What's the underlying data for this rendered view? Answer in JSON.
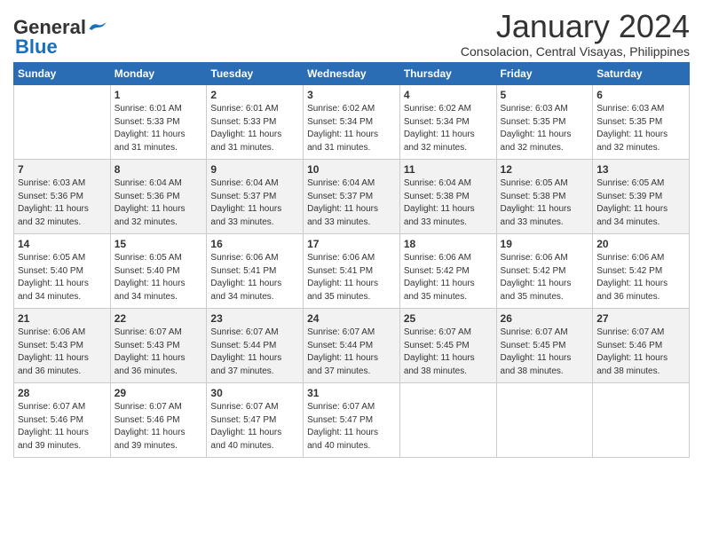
{
  "header": {
    "logo_general": "General",
    "logo_blue": "Blue",
    "month_title": "January 2024",
    "location": "Consolacion, Central Visayas, Philippines"
  },
  "days_of_week": [
    "Sunday",
    "Monday",
    "Tuesday",
    "Wednesday",
    "Thursday",
    "Friday",
    "Saturday"
  ],
  "weeks": [
    [
      {
        "day": "",
        "info": ""
      },
      {
        "day": "1",
        "info": "Sunrise: 6:01 AM\nSunset: 5:33 PM\nDaylight: 11 hours\nand 31 minutes."
      },
      {
        "day": "2",
        "info": "Sunrise: 6:01 AM\nSunset: 5:33 PM\nDaylight: 11 hours\nand 31 minutes."
      },
      {
        "day": "3",
        "info": "Sunrise: 6:02 AM\nSunset: 5:34 PM\nDaylight: 11 hours\nand 31 minutes."
      },
      {
        "day": "4",
        "info": "Sunrise: 6:02 AM\nSunset: 5:34 PM\nDaylight: 11 hours\nand 32 minutes."
      },
      {
        "day": "5",
        "info": "Sunrise: 6:03 AM\nSunset: 5:35 PM\nDaylight: 11 hours\nand 32 minutes."
      },
      {
        "day": "6",
        "info": "Sunrise: 6:03 AM\nSunset: 5:35 PM\nDaylight: 11 hours\nand 32 minutes."
      }
    ],
    [
      {
        "day": "7",
        "info": "Sunrise: 6:03 AM\nSunset: 5:36 PM\nDaylight: 11 hours\nand 32 minutes."
      },
      {
        "day": "8",
        "info": "Sunrise: 6:04 AM\nSunset: 5:36 PM\nDaylight: 11 hours\nand 32 minutes."
      },
      {
        "day": "9",
        "info": "Sunrise: 6:04 AM\nSunset: 5:37 PM\nDaylight: 11 hours\nand 33 minutes."
      },
      {
        "day": "10",
        "info": "Sunrise: 6:04 AM\nSunset: 5:37 PM\nDaylight: 11 hours\nand 33 minutes."
      },
      {
        "day": "11",
        "info": "Sunrise: 6:04 AM\nSunset: 5:38 PM\nDaylight: 11 hours\nand 33 minutes."
      },
      {
        "day": "12",
        "info": "Sunrise: 6:05 AM\nSunset: 5:38 PM\nDaylight: 11 hours\nand 33 minutes."
      },
      {
        "day": "13",
        "info": "Sunrise: 6:05 AM\nSunset: 5:39 PM\nDaylight: 11 hours\nand 34 minutes."
      }
    ],
    [
      {
        "day": "14",
        "info": "Sunrise: 6:05 AM\nSunset: 5:40 PM\nDaylight: 11 hours\nand 34 minutes."
      },
      {
        "day": "15",
        "info": "Sunrise: 6:05 AM\nSunset: 5:40 PM\nDaylight: 11 hours\nand 34 minutes."
      },
      {
        "day": "16",
        "info": "Sunrise: 6:06 AM\nSunset: 5:41 PM\nDaylight: 11 hours\nand 34 minutes."
      },
      {
        "day": "17",
        "info": "Sunrise: 6:06 AM\nSunset: 5:41 PM\nDaylight: 11 hours\nand 35 minutes."
      },
      {
        "day": "18",
        "info": "Sunrise: 6:06 AM\nSunset: 5:42 PM\nDaylight: 11 hours\nand 35 minutes."
      },
      {
        "day": "19",
        "info": "Sunrise: 6:06 AM\nSunset: 5:42 PM\nDaylight: 11 hours\nand 35 minutes."
      },
      {
        "day": "20",
        "info": "Sunrise: 6:06 AM\nSunset: 5:42 PM\nDaylight: 11 hours\nand 36 minutes."
      }
    ],
    [
      {
        "day": "21",
        "info": "Sunrise: 6:06 AM\nSunset: 5:43 PM\nDaylight: 11 hours\nand 36 minutes."
      },
      {
        "day": "22",
        "info": "Sunrise: 6:07 AM\nSunset: 5:43 PM\nDaylight: 11 hours\nand 36 minutes."
      },
      {
        "day": "23",
        "info": "Sunrise: 6:07 AM\nSunset: 5:44 PM\nDaylight: 11 hours\nand 37 minutes."
      },
      {
        "day": "24",
        "info": "Sunrise: 6:07 AM\nSunset: 5:44 PM\nDaylight: 11 hours\nand 37 minutes."
      },
      {
        "day": "25",
        "info": "Sunrise: 6:07 AM\nSunset: 5:45 PM\nDaylight: 11 hours\nand 38 minutes."
      },
      {
        "day": "26",
        "info": "Sunrise: 6:07 AM\nSunset: 5:45 PM\nDaylight: 11 hours\nand 38 minutes."
      },
      {
        "day": "27",
        "info": "Sunrise: 6:07 AM\nSunset: 5:46 PM\nDaylight: 11 hours\nand 38 minutes."
      }
    ],
    [
      {
        "day": "28",
        "info": "Sunrise: 6:07 AM\nSunset: 5:46 PM\nDaylight: 11 hours\nand 39 minutes."
      },
      {
        "day": "29",
        "info": "Sunrise: 6:07 AM\nSunset: 5:46 PM\nDaylight: 11 hours\nand 39 minutes."
      },
      {
        "day": "30",
        "info": "Sunrise: 6:07 AM\nSunset: 5:47 PM\nDaylight: 11 hours\nand 40 minutes."
      },
      {
        "day": "31",
        "info": "Sunrise: 6:07 AM\nSunset: 5:47 PM\nDaylight: 11 hours\nand 40 minutes."
      },
      {
        "day": "",
        "info": ""
      },
      {
        "day": "",
        "info": ""
      },
      {
        "day": "",
        "info": ""
      }
    ]
  ]
}
